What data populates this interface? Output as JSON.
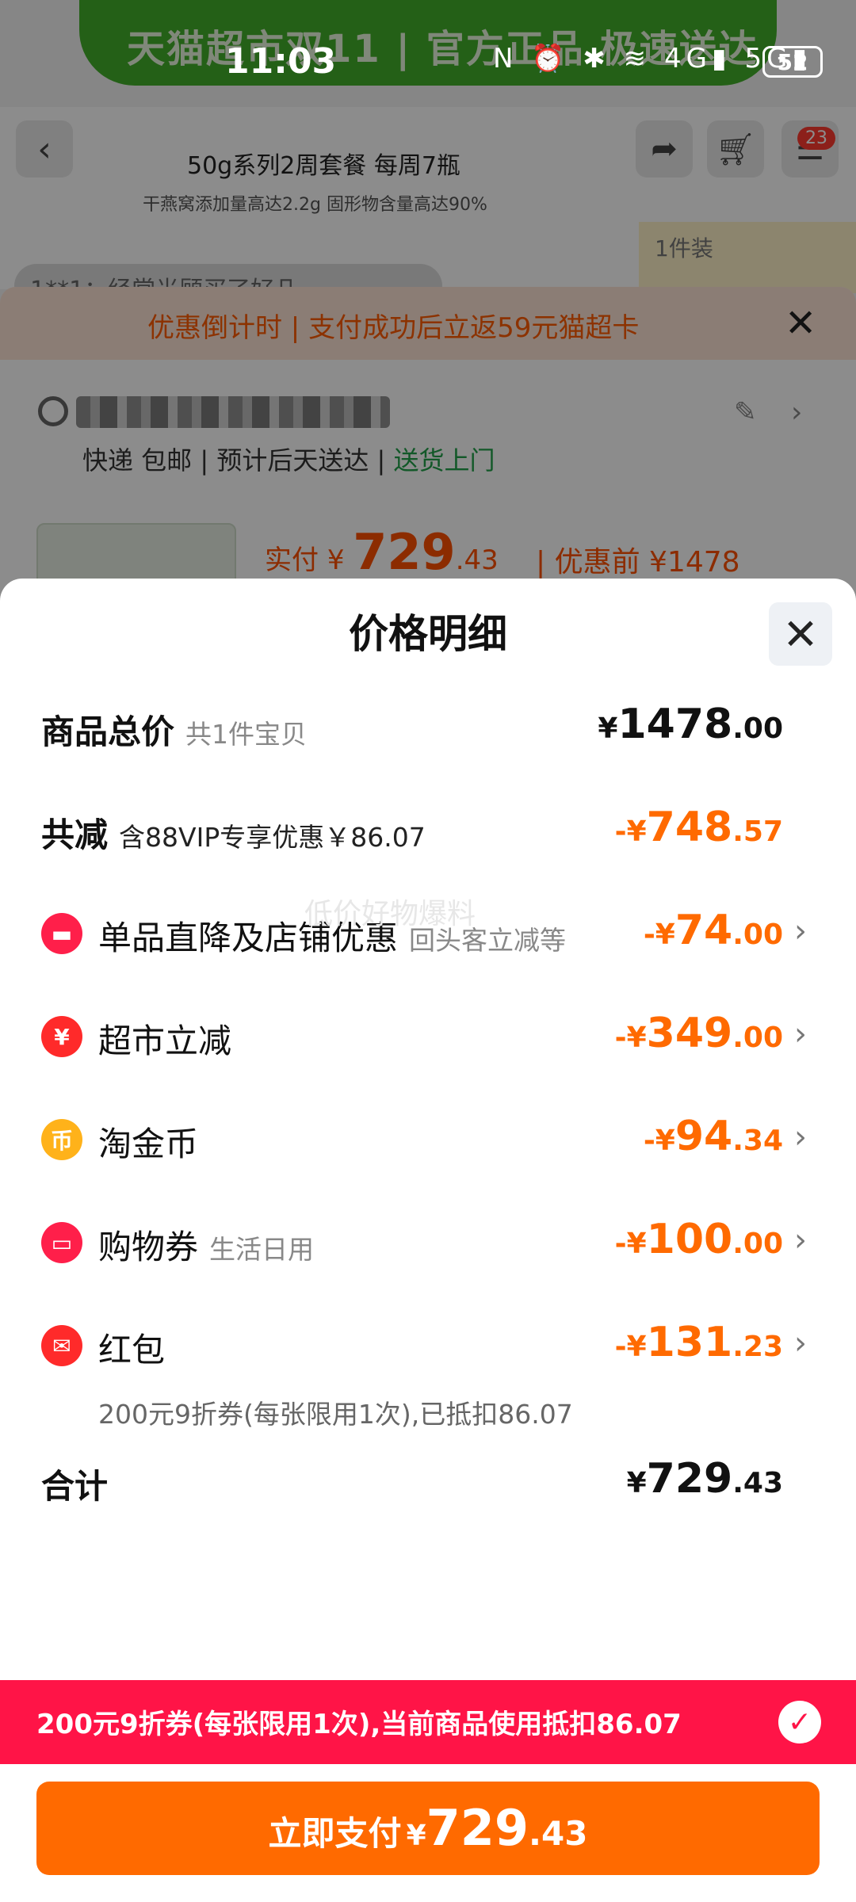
{
  "status_bar": {
    "time": "11:03",
    "icons_text": "N ⏰ ✱ ≋ 4G▮ 5G▮",
    "battery": "52"
  },
  "background": {
    "banner_text": "天猫超市双11 | 官方正品 极速送达",
    "product_title": "50g系列2周套餐 每周7瓶",
    "product_subtitle": "干燕窝添加量高达2.2g  固形物含量高达90%",
    "review_snippet": "1**1：经常光顾买了好几",
    "pack_label": "1件装",
    "cart_badge": "23",
    "countdown_text": "优惠倒计时 | 支付成功后立返59元猫超卡",
    "shipping": {
      "method": "快递 包邮",
      "eta": "预计后天送达",
      "home_delivery": "送货上门"
    },
    "paid_label": "实付",
    "paid_currency": "¥",
    "paid_int": "729",
    "paid_dec": ".43",
    "pre_discount": "| 优惠前 ¥1478"
  },
  "sheet": {
    "title": "价格明细",
    "watermark": "低价好物爆料",
    "total_goods": {
      "label": "商品总价",
      "sub": "共1件宝贝",
      "currency": "¥",
      "int": "1478",
      "dec": ".00"
    },
    "total_reduce": {
      "label": "共减",
      "sub": "含88VIP专享优惠￥86.07",
      "currency": "-¥",
      "int": "748",
      "dec": ".57"
    },
    "items": [
      {
        "label": "单品直降及店铺优惠",
        "sub": "回头客立减等",
        "icon_char": "▬",
        "icon_name": "shop-discount-icon",
        "icon_color": "#ff1f4a",
        "currency": "-¥",
        "int": "74",
        "dec": ".00"
      },
      {
        "label": "超市立减",
        "sub": "",
        "icon_char": "¥",
        "icon_name": "supermarket-discount-icon",
        "icon_color": "#ff2a2a",
        "currency": "-¥",
        "int": "349",
        "dec": ".00"
      },
      {
        "label": "淘金币",
        "sub": "",
        "icon_char": "币",
        "icon_name": "gold-coin-icon",
        "icon_color": "#ffb21a",
        "currency": "-¥",
        "int": "94",
        "dec": ".34"
      },
      {
        "label": "购物券",
        "sub": "生活日用",
        "icon_char": "▭",
        "icon_name": "shopping-voucher-icon",
        "icon_color": "#ff1f4a",
        "currency": "-¥",
        "int": "100",
        "dec": ".00"
      },
      {
        "label": "红包",
        "sub": "",
        "icon_char": "✉",
        "icon_name": "red-envelope-icon",
        "icon_color": "#ff2a2a",
        "currency": "-¥",
        "int": "131",
        "dec": ".23"
      }
    ],
    "red_packet_note": "200元9折券(每张限用1次),已抵扣86.07",
    "sum": {
      "label": "合计",
      "currency": "¥",
      "int": "729",
      "dec": ".43"
    }
  },
  "coupon_bar": {
    "text": "200元9折券(每张限用1次),当前商品使用抵扣86.07",
    "checked": true
  },
  "pay_button": {
    "label": "立即支付",
    "currency": "¥",
    "int": "729",
    "dec": ".43"
  },
  "colors": {
    "accent_orange": "#ff6a00",
    "coupon_red": "#ff1447",
    "discount_orange": "#ff6a00"
  }
}
